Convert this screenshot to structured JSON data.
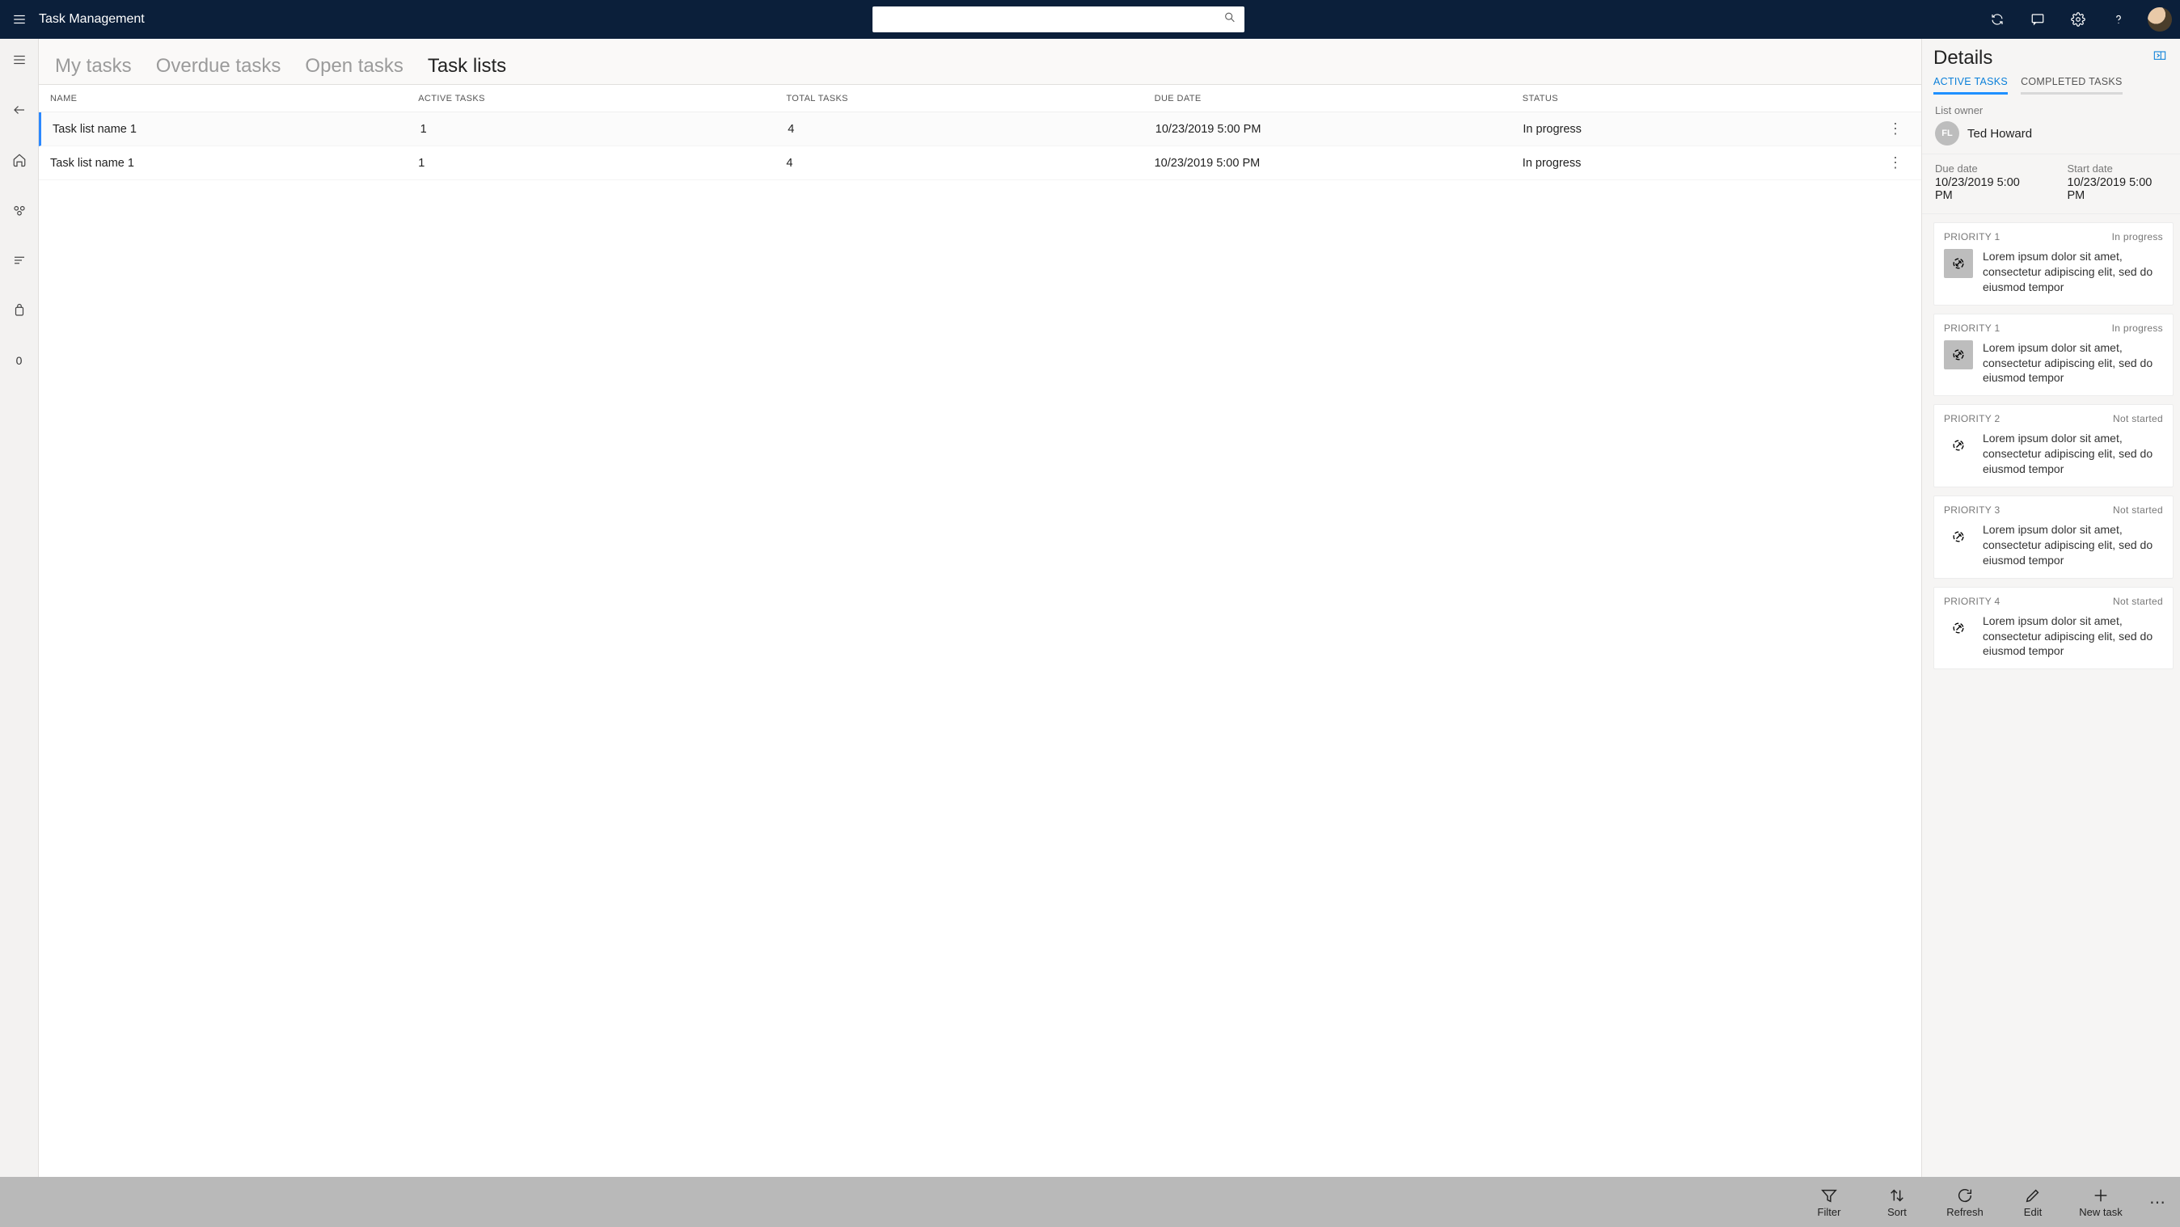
{
  "header": {
    "title": "Task Management",
    "search_placeholder": ""
  },
  "tabs": [
    {
      "label": "My tasks"
    },
    {
      "label": "Overdue tasks"
    },
    {
      "label": "Open tasks"
    },
    {
      "label": "Task lists"
    }
  ],
  "table": {
    "columns": [
      "NAME",
      "ACTIVE TASKS",
      "TOTAL TASKS",
      "DUE DATE",
      "STATUS"
    ],
    "rows": [
      {
        "name": "Task list name 1",
        "active": "1",
        "total": "4",
        "due": "10/23/2019 5:00 PM",
        "status": "In progress"
      },
      {
        "name": "Task list name 1",
        "active": "1",
        "total": "4",
        "due": "10/23/2019 5:00 PM",
        "status": "In progress"
      }
    ]
  },
  "details": {
    "title": "Details",
    "tabs": {
      "active": "ACTIVE TASKS",
      "completed": "COMPLETED TASKS"
    },
    "owner_label": "List owner",
    "owner_initials": "FL",
    "owner_name": "Ted Howard",
    "due_label": "Due date",
    "due_value": "10/23/2019 5:00 PM",
    "start_label": "Start date",
    "start_value": "10/23/2019 5:00 PM",
    "tasks": [
      {
        "priority": "PRIORITY 1",
        "status": "In progress",
        "filled": true,
        "desc": "Lorem ipsum dolor sit amet, consectetur adipiscing elit, sed do eiusmod tempor"
      },
      {
        "priority": "PRIORITY 1",
        "status": "In progress",
        "filled": true,
        "desc": "Lorem ipsum dolor sit amet, consectetur adipiscing elit, sed do eiusmod tempor"
      },
      {
        "priority": "PRIORITY 2",
        "status": "Not started",
        "filled": false,
        "desc": "Lorem ipsum dolor sit amet, consectetur adipiscing elit, sed do eiusmod tempor"
      },
      {
        "priority": "PRIORITY 3",
        "status": "Not started",
        "filled": false,
        "desc": "Lorem ipsum dolor sit amet, consectetur adipiscing elit, sed do eiusmod tempor"
      },
      {
        "priority": "PRIORITY 4",
        "status": "Not started",
        "filled": false,
        "desc": "Lorem ipsum dolor sit amet, consectetur adipiscing elit, sed do eiusmod tempor"
      }
    ]
  },
  "commands": {
    "filter": "Filter",
    "sort": "Sort",
    "refresh": "Refresh",
    "edit": "Edit",
    "newtask": "New task"
  },
  "rail": {
    "count": "0"
  }
}
